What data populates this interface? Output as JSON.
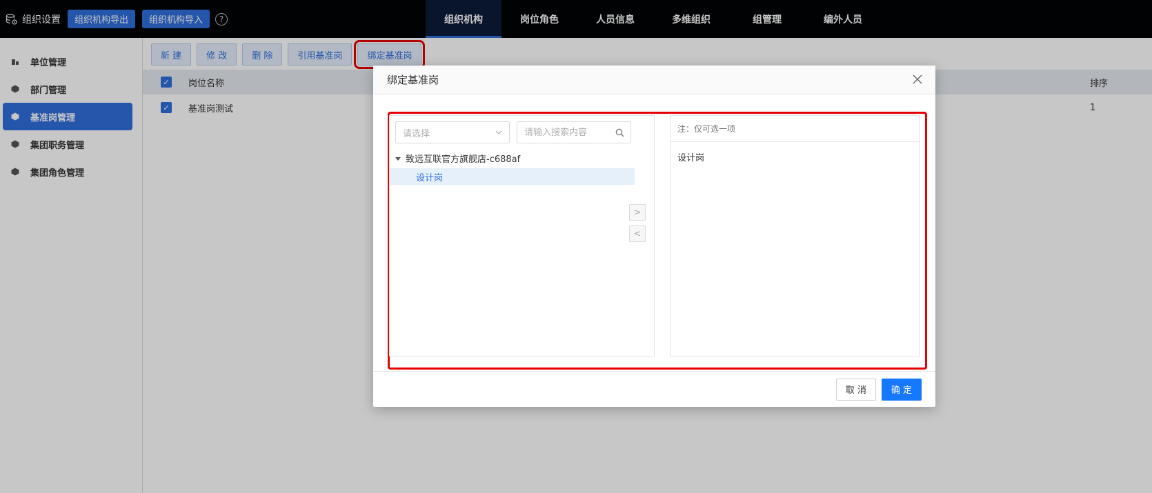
{
  "header": {
    "brand": "组织设置",
    "export_button": "组织机构导出",
    "import_button": "组织机构导入",
    "help_glyph": "?",
    "nav": [
      {
        "label": "组织机构",
        "active": true
      },
      {
        "label": "岗位角色",
        "active": false
      },
      {
        "label": "人员信息",
        "active": false
      },
      {
        "label": "多维组织",
        "active": false
      },
      {
        "label": "组管理",
        "active": false
      },
      {
        "label": "编外人员",
        "active": false
      }
    ]
  },
  "sidebar": {
    "items": [
      {
        "label": "单位管理",
        "icon": "building-icon",
        "active": false
      },
      {
        "label": "部门管理",
        "icon": "cube-icon",
        "active": false
      },
      {
        "label": "基准岗管理",
        "icon": "cube-icon",
        "active": true
      },
      {
        "label": "集团职务管理",
        "icon": "cube-icon",
        "active": false
      },
      {
        "label": "集团角色管理",
        "icon": "cube-icon",
        "active": false
      }
    ]
  },
  "toolbar": {
    "new": "新 建",
    "edit": "修 改",
    "delete": "删 除",
    "reference": "引用基准岗",
    "bind": "绑定基准岗"
  },
  "grid": {
    "columns": {
      "name": "岗位名称",
      "sort": "排序"
    },
    "rows": [
      {
        "name": "基准岗测试",
        "sort": "1",
        "checked": true
      }
    ]
  },
  "modal": {
    "title": "绑定基准岗",
    "select_placeholder": "请选择",
    "search_placeholder": "请输入搜索内容",
    "tree": {
      "root": "致远互联官方旗舰店-c688af",
      "children": [
        "设计岗"
      ]
    },
    "move_right": ">",
    "move_left": "<",
    "right_note": "注：仅可选一项",
    "selected": [
      "设计岗"
    ],
    "cancel": "取 消",
    "ok": "确 定"
  },
  "colors": {
    "topbar": "#020306",
    "accent": "#2f6fdc",
    "highlight": "#e60000",
    "ok_button": "#1677ff"
  }
}
